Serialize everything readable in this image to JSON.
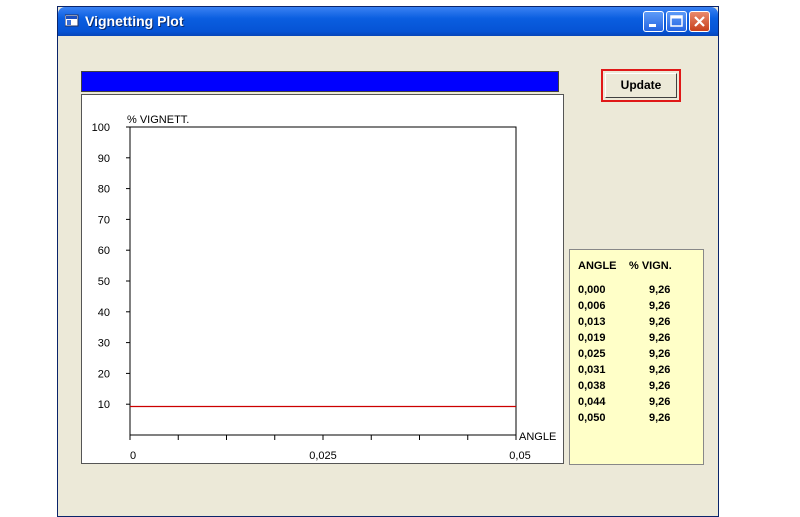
{
  "window": {
    "title": "Vignetting Plot"
  },
  "titlebar_buttons": {
    "minimize_icon": "minimize-icon",
    "maximize_icon": "maximize-icon",
    "close_icon": "close-icon"
  },
  "progress": {
    "color": "#0000ff",
    "value": 1.0
  },
  "update_button": {
    "label": "Update",
    "border_color": "#e01818"
  },
  "chart_data": {
    "type": "line",
    "ylabel": "% VIGNETT.",
    "xlabel": "ANGLE",
    "ylim": [
      0,
      100
    ],
    "xlim": [
      0,
      0.05
    ],
    "y_ticks": [
      "100",
      "90",
      "80",
      "70",
      "60",
      "50",
      "40",
      "30",
      "20",
      "10"
    ],
    "x_tick_labels": [
      "0",
      "0,025",
      "0,05"
    ],
    "series": [
      {
        "color": "#cc0000",
        "x": [
          0.0,
          0.006,
          0.013,
          0.019,
          0.025,
          0.031,
          0.038,
          0.044,
          0.05
        ],
        "y": [
          9.26,
          9.26,
          9.26,
          9.26,
          9.26,
          9.26,
          9.26,
          9.26,
          9.26
        ]
      }
    ]
  },
  "table": {
    "headers": [
      "ANGLE",
      "% VIGN."
    ],
    "rows": [
      [
        "0,000",
        "9,26"
      ],
      [
        "0,006",
        "9,26"
      ],
      [
        "0,013",
        "9,26"
      ],
      [
        "0,019",
        "9,26"
      ],
      [
        "0,025",
        "9,26"
      ],
      [
        "0,031",
        "9,26"
      ],
      [
        "0,038",
        "9,26"
      ],
      [
        "0,044",
        "9,26"
      ],
      [
        "0,050",
        "9,26"
      ]
    ],
    "background": "#ffffc8"
  }
}
